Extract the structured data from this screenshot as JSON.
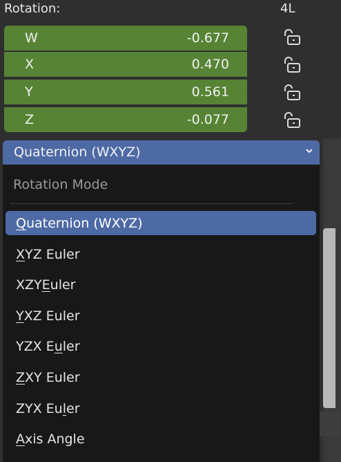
{
  "rotation": {
    "label": "Rotation:",
    "extra": "4L"
  },
  "fields": [
    {
      "axis": "W",
      "value": "-0.677"
    },
    {
      "axis": "X",
      "value": "0.470"
    },
    {
      "axis": "Y",
      "value": "0.561"
    },
    {
      "axis": "Z",
      "value": "-0.077"
    }
  ],
  "dropdown": {
    "selected": "Quaternion (WXYZ)",
    "title": "Rotation Mode"
  },
  "items": [
    {
      "pre": "",
      "u": "Q",
      "post": "uaternion (WXYZ)"
    },
    {
      "pre": "",
      "u": "X",
      "post": "YZ Euler"
    },
    {
      "pre": "XZY ",
      "u": "E",
      "post": "uler"
    },
    {
      "pre": "",
      "u": "Y",
      "post": "XZ Euler"
    },
    {
      "pre": "YZX E",
      "u": "u",
      "post": "ler"
    },
    {
      "pre": "",
      "u": "Z",
      "post": "XY Euler"
    },
    {
      "pre": "ZYX Eu",
      "u": "l",
      "post": "er"
    },
    {
      "pre": "",
      "u": "A",
      "post": "xis Angle"
    }
  ],
  "colors": {
    "field": "#568434",
    "accent": "#4e6aa5",
    "menu_bg": "#181818"
  },
  "icons": {
    "lock": "lock-open-icon",
    "chevron": "chevron-down-icon"
  }
}
